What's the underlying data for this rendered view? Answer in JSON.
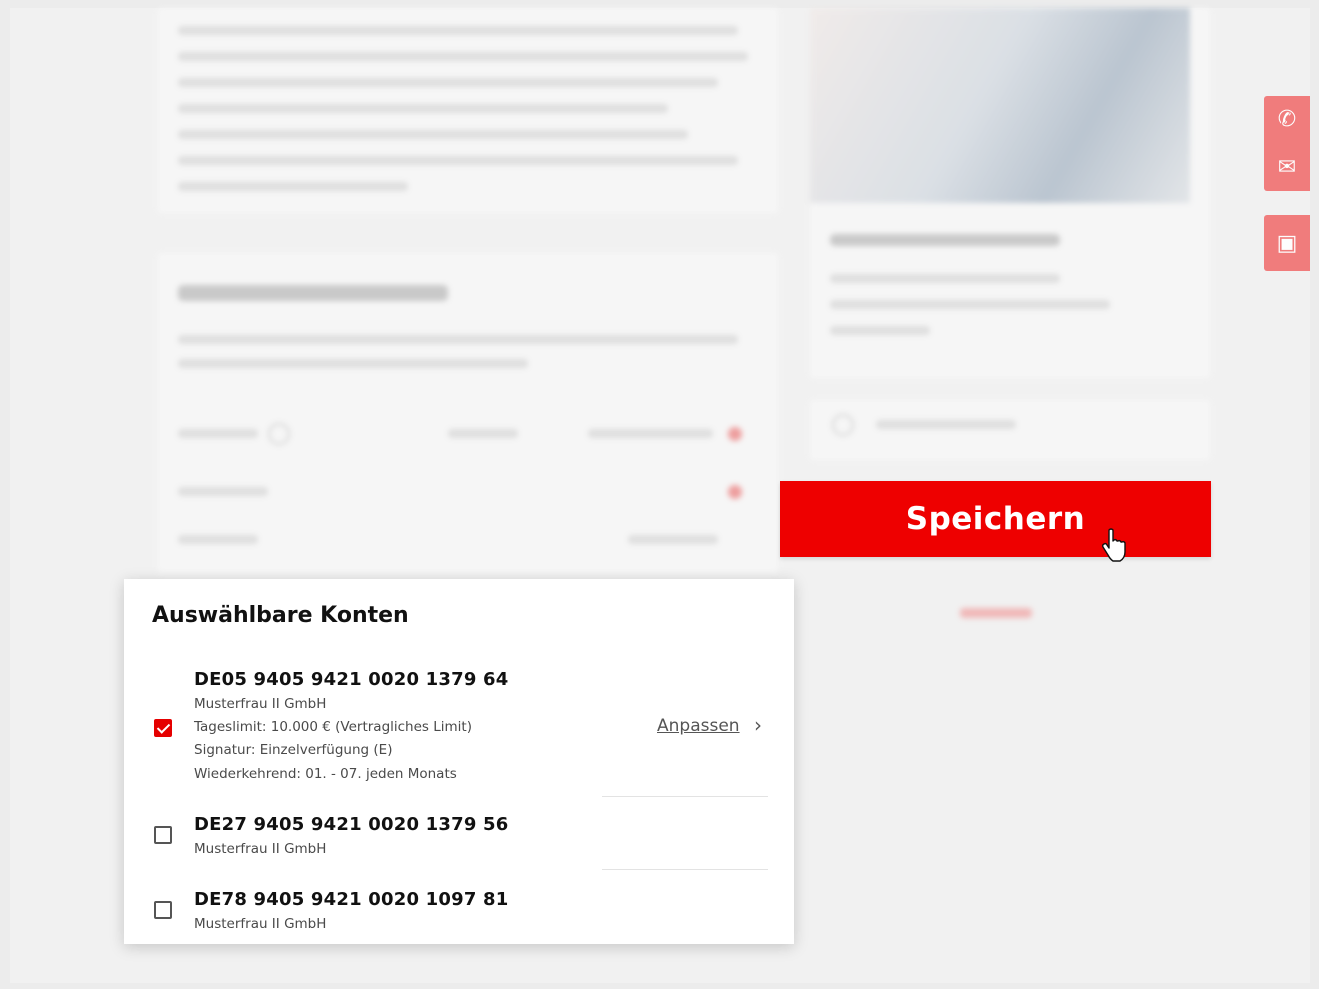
{
  "save_label": "Speichern",
  "accounts_panel": {
    "title": "Auswählbare Konten",
    "adjust_label": "Anpassen",
    "items": [
      {
        "iban": "DE05 9405 9421 0020 1379 64",
        "holder": "Musterfrau II GmbH",
        "limit": "Tageslimit: 10.000 € (Vertragliches Limit)",
        "signature": "Signatur: Einzelverfügung (E)",
        "recurring": "Wiederkehrend: 01. - 07. jeden Monats",
        "checked": true
      },
      {
        "iban": "DE27 9405 9421 0020 1379 56",
        "holder": "Musterfrau II GmbH",
        "checked": false
      },
      {
        "iban": "DE78 9405 9421 0020 1097 81",
        "holder": "Musterfrau II GmbH",
        "checked": false
      }
    ]
  },
  "colors": {
    "accent": "#ee0000",
    "checkbox_checked": "#e50000",
    "background": "#f1f1f1"
  },
  "icons": {
    "side_tab_top": [
      "phone-icon",
      "mail-icon"
    ],
    "side_tab_bottom": "chat-icon",
    "pointer": "hand-cursor-icon"
  }
}
